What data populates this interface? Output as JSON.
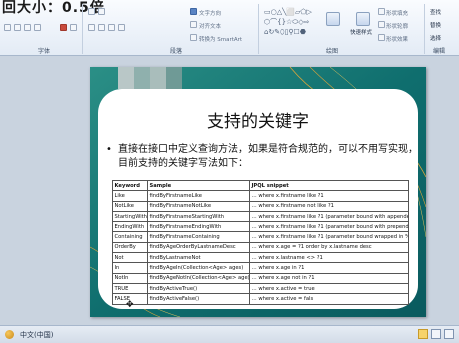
{
  "zoom_caption": "回大小：0.5倍",
  "ribbon": {
    "groups": {
      "font": "字体",
      "paragraph": "段落",
      "drawing": "绘图",
      "editing": "编辑"
    },
    "paragraph_items": {
      "text_direction": "文字方向",
      "align_text": "对齐文本",
      "smartart": "转换为 SmartArt"
    },
    "drawing_items": {
      "quick_styles": "快速样式",
      "shape_fill": "形状填充",
      "shape_outline": "形状轮廓",
      "shape_effects": "形状效果"
    },
    "editing_items": {
      "find": "查找",
      "replace": "替换",
      "select": "选择"
    }
  },
  "slide": {
    "title": "支持的关键字",
    "bullet": "直接在接口中定义查询方法，如果是符合规范的，可以不用写实现，目前支持的关键字写法如下：",
    "table": {
      "headers": [
        "Keyword",
        "Sample",
        "JPQL snippet"
      ],
      "rows": [
        [
          "Like",
          "findByFirstnameLike",
          "… where x.firstname like ?1"
        ],
        [
          "NotLike",
          "findByFirstnameNotLike",
          "… where x.firstname not like ?1"
        ],
        [
          "StartingWith",
          "findByFirstnameStartingWith",
          "… where x.firstname like ?1 (parameter bound with appended %)"
        ],
        [
          "EndingWith",
          "findByFirstnameEndingWith",
          "… where x.firstname like ?1 (parameter bound with prepended %)"
        ],
        [
          "Containing",
          "findByFirstnameContaining",
          "… where x.firstname like ?1 (parameter bound wrapped in %)"
        ],
        [
          "OrderBy",
          "findByAgeOrderByLastnameDesc",
          "… where x.age = ?1 order by x.lastname desc"
        ],
        [
          "Not",
          "findByLastnameNot",
          "… where x.lastname <> ?1"
        ],
        [
          "In",
          "findByAgeIn(Collection<Age> ages)",
          "… where x.age in ?1"
        ],
        [
          "NotIn",
          "findByAgeNotIn(Collection<Age> age)",
          "… where x.age not in ?1"
        ],
        [
          "TRUE",
          "findByActiveTrue()",
          "… where x.active = true"
        ],
        [
          "FALSE",
          "findByActiveFalse()",
          "… where x.active = fals"
        ]
      ]
    }
  },
  "status": {
    "language": "中文(中国)"
  },
  "colors": {
    "slide_bg": "#0f6e6e",
    "accent_gold": "#d8a43a",
    "ribbon_bg": "#e3ebf5"
  }
}
